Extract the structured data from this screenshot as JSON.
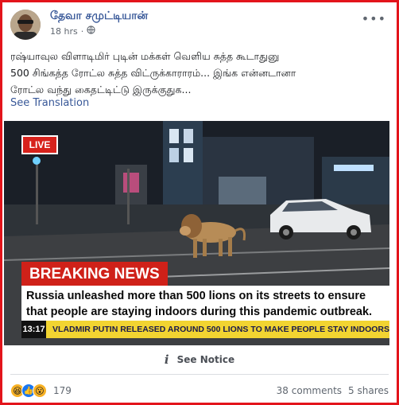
{
  "post": {
    "author": "தேவா சமுட்டியான்",
    "time": "18 hrs",
    "privacy_icon": "globe-icon",
    "more_icon": "more-options-icon",
    "text_lines": [
      "ரஷ்யாவுல விளாடிமிர் புடின் மக்கள் வெளிய சுத்த கூடாதுனு",
      "500 சிங்கத்த ரோட்ல சுத்த விட்ருக்காராரம்... இங்க என்னடானா",
      "ரோட்ல வந்து கைதட்டிட்டு இருக்குதுக..."
    ],
    "see_translation": "See Translation"
  },
  "image": {
    "live": "LIVE",
    "breaking": "BREAKING NEWS",
    "headline_lines": [
      "Russia unleashed more than 500 lions on its streets to ensure",
      "that people are staying indoors during this pandemic outbreak."
    ],
    "ticker_time": "13:17",
    "ticker_text": "VLADMIR PUTIN RELEASED AROUND 500 LIONS TO MAKE PEOPLE STAY INDOORS"
  },
  "notice": {
    "icon": "info-icon",
    "label": "See Notice"
  },
  "footer": {
    "reactions": [
      "haha",
      "like",
      "wow"
    ],
    "reaction_count": "179",
    "comments": "38 comments",
    "shares": "5 shares"
  }
}
